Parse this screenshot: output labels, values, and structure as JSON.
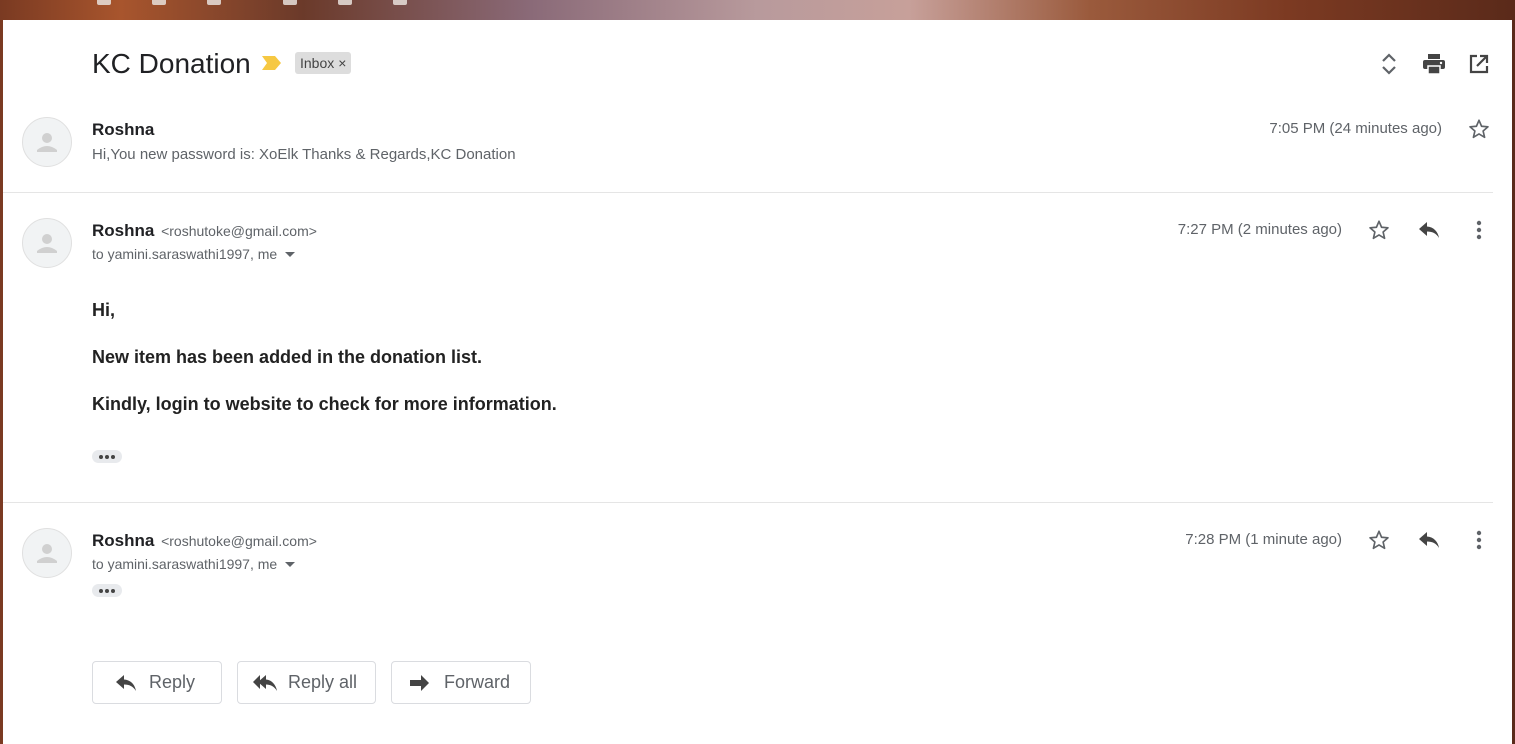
{
  "thread": {
    "subject": "KC Donation",
    "label": "Inbox",
    "label_remove": "×"
  },
  "colors": {
    "important_marker": "#f6c842",
    "label_bg": "#dddddd"
  },
  "icons": {
    "expand_all": "unfold-more-icon",
    "print": "print-icon",
    "new_window": "open-in-new-icon",
    "star": "star-outline-icon",
    "reply": "reply-icon",
    "reply_all": "reply-all-icon",
    "forward": "forward-icon",
    "more": "more-vert-icon",
    "avatar": "person-icon"
  },
  "messages": [
    {
      "sender": "Roshna",
      "snippet": "Hi,You new password is: XoElk Thanks & Regards,KC Donation",
      "time": "7:05 PM (24 minutes ago)"
    },
    {
      "sender": "Roshna",
      "email": "<roshutoke@gmail.com>",
      "recipients": "to yamini.saraswathi1997, me",
      "time": "7:27 PM (2 minutes ago)",
      "body": [
        "Hi,",
        "New item has been added in the donation list.",
        "Kindly, login to website to check for more information."
      ]
    },
    {
      "sender": "Roshna",
      "email": "<roshutoke@gmail.com>",
      "recipients": "to yamini.saraswathi1997, me",
      "time": "7:28 PM (1 minute ago)"
    }
  ],
  "actions": {
    "reply": "Reply",
    "reply_all": "Reply all",
    "forward": "Forward"
  }
}
